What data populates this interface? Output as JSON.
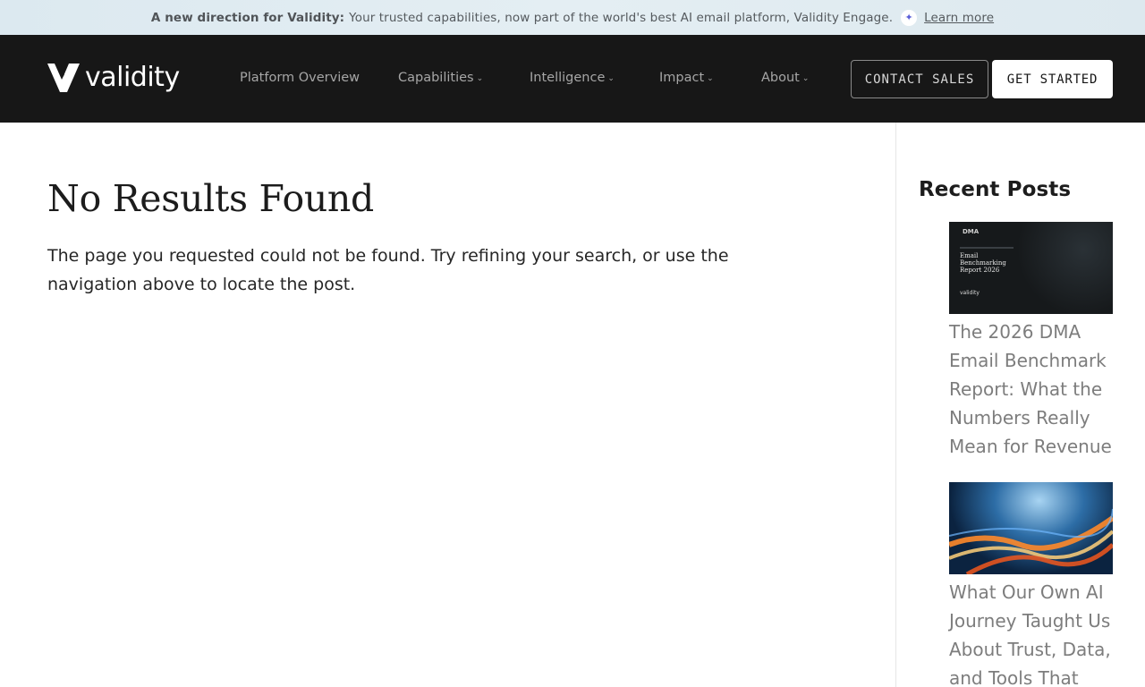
{
  "announcement": {
    "bold": "A new direction for Validity:",
    "text": "Your trusted capabilities, now part of the world's best AI email platform, Validity Engage.",
    "spark_icon": "sparkle-icon",
    "link": "Learn more"
  },
  "header": {
    "logo_text": "validity",
    "nav": [
      {
        "label": "Platform Overview",
        "has_dropdown": false
      },
      {
        "label": "Capabilities",
        "has_dropdown": true
      },
      {
        "label": "Intelligence",
        "has_dropdown": true
      },
      {
        "label": "Impact",
        "has_dropdown": true
      },
      {
        "label": "About",
        "has_dropdown": true
      }
    ],
    "contact_label": "CONTACT SALES",
    "start_label": "GET STARTED"
  },
  "main": {
    "title": "No Results Found",
    "text": "The page you requested could not be found. Try refining your search, or use the navigation above to locate the post."
  },
  "sidebar": {
    "title": "Recent Posts",
    "posts": [
      {
        "title": "The 2026 DMA Email Benchmark Report: What the Numbers Really Mean for Revenue",
        "thumb_logo": "DMA",
        "thumb_heading": "Email Benchmarking Report 2026",
        "thumb_brand": "validity"
      },
      {
        "title": "What Our Own AI Journey Taught Us About Trust, Data, and Tools That"
      }
    ]
  },
  "colors": {
    "header_bg": "#171717",
    "announce_bg": "#dde9ef",
    "post_link": "#7d7d7d"
  }
}
